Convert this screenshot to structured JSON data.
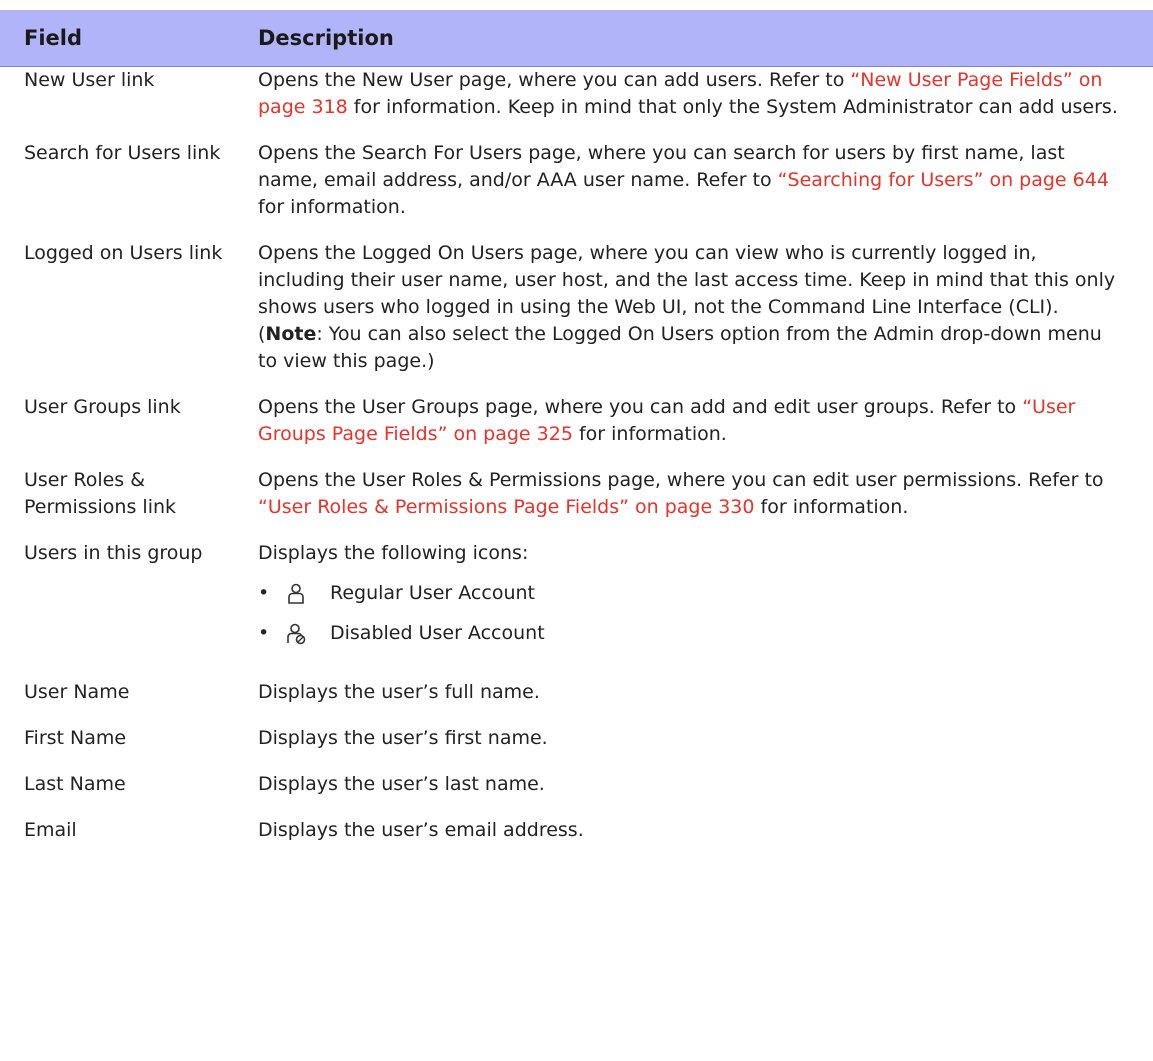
{
  "header": {
    "field_label": "Field",
    "description_label": "Description"
  },
  "rows": [
    {
      "field": "New User link",
      "text1": "Opens the New User page, where you can add users. Refer to ",
      "link": "“New User Page Fields” on page 318",
      "text2": " for information. Keep in mind that only the System Administrator can add users."
    },
    {
      "field": "Search for Users link",
      "text1": "Opens the Search For Users page, where you can search for users by first name, last name, email address, and/or AAA user name. Refer to ",
      "link": "“Searching for Users” on page 644",
      "text2": " for information."
    },
    {
      "field": "Logged on Users link",
      "text1": "Opens the Logged On Users page, where you can view who is currently logged in, including their user name, user host, and the last access time. Keep in mind that this only shows users who logged in using the Web UI, not the Command Line Interface (CLI). (",
      "bold": "Note",
      "text2": ": You can also select the Logged On Users option from the Admin drop-down menu to view this page.)"
    },
    {
      "field": "User Groups link",
      "text1": "Opens the User Groups page, where you can add and edit user groups. Refer to ",
      "link": "“User Groups Page Fields” on page 325",
      "text2": " for information."
    },
    {
      "field": "User Roles & Permissions link",
      "text1": "Opens the User Roles & Permissions page, where you can edit user permissions. Refer to ",
      "link": "“User Roles & Permissions Page Fields” on page 330",
      "text2": " for information."
    },
    {
      "field": "Users in this group",
      "text1": "Displays the following icons:",
      "icons": [
        {
          "icon": "regular-user-icon",
          "label": "Regular User Account"
        },
        {
          "icon": "disabled-user-icon",
          "label": "Disabled User Account"
        }
      ]
    },
    {
      "field": "User Name",
      "text1": "Displays the user’s full name."
    },
    {
      "field": "First Name",
      "text1": "Displays the user’s first name."
    },
    {
      "field": "Last Name",
      "text1": "Displays the user’s last name."
    },
    {
      "field": "Email",
      "text1": "Displays the user’s email address."
    }
  ],
  "colors": {
    "header_bg": "#b1b4f8",
    "link": "#e8322a",
    "text": "#222222"
  }
}
